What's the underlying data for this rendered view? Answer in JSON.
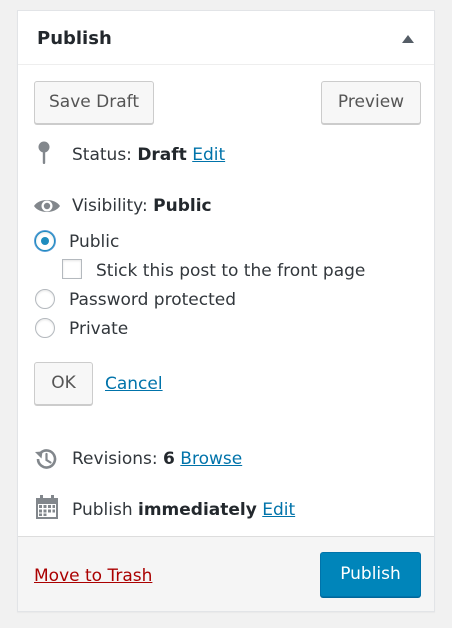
{
  "panel": {
    "title": "Publish"
  },
  "actions": {
    "save_draft_label": "Save Draft",
    "preview_label": "Preview"
  },
  "status": {
    "label": "Status:",
    "value": "Draft",
    "edit_label": "Edit"
  },
  "visibility": {
    "label": "Visibility:",
    "value": "Public",
    "options": [
      {
        "label": "Public",
        "checked": true
      },
      {
        "label": "Password protected",
        "checked": false
      },
      {
        "label": "Private",
        "checked": false
      }
    ],
    "sticky_label": "Stick this post to the front page",
    "sticky_checked": false,
    "ok_label": "OK",
    "cancel_label": "Cancel"
  },
  "revisions": {
    "label": "Revisions:",
    "count": "6",
    "browse_label": "Browse"
  },
  "schedule": {
    "label": "Publish",
    "value": "immediately",
    "edit_label": "Edit"
  },
  "footer": {
    "trash_label": "Move to Trash",
    "publish_label": "Publish"
  },
  "icons": {
    "collapse": "triangle-up-icon",
    "status": "pin-icon",
    "visibility": "eye-icon",
    "revisions": "history-icon",
    "schedule": "calendar-icon"
  },
  "colors": {
    "link": "#0073aa",
    "trash": "#aa0000",
    "publish_button": "#0085ba",
    "radio_accent": "#1e8cbe"
  }
}
